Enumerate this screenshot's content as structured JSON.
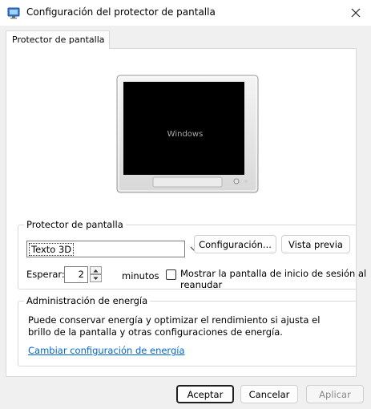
{
  "window": {
    "title": "Configuración del protector de pantalla"
  },
  "tabs": [
    {
      "label": "Protector de pantalla"
    }
  ],
  "preview": {
    "text": "Windows"
  },
  "screensaver_group": {
    "legend": "Protector de pantalla",
    "selected": "Texto 3D",
    "settings_button": "Configuración...",
    "preview_button": "Vista previa",
    "wait_label": "Esperar:",
    "wait_value": "2",
    "minutes_label": "minutos",
    "resume_checkbox_line1": "Mostrar la pantalla de inicio de sesión al",
    "resume_checkbox_line2": "reanudar",
    "resume_checked": false
  },
  "power_group": {
    "legend": "Administración de energía",
    "description_line1": "Puede conservar energía y optimizar el rendimiento si ajusta el",
    "description_line2": "brillo de la pantalla y otras configuraciones de energía.",
    "link": "Cambiar configuración de energía"
  },
  "footer": {
    "accept": "Aceptar",
    "cancel": "Cancelar",
    "apply": "Aplicar"
  },
  "colors": {
    "link": "#0066cc",
    "window_bg": "#f0f0f0",
    "panel_bg": "#ffffff",
    "screen": "#000000"
  }
}
